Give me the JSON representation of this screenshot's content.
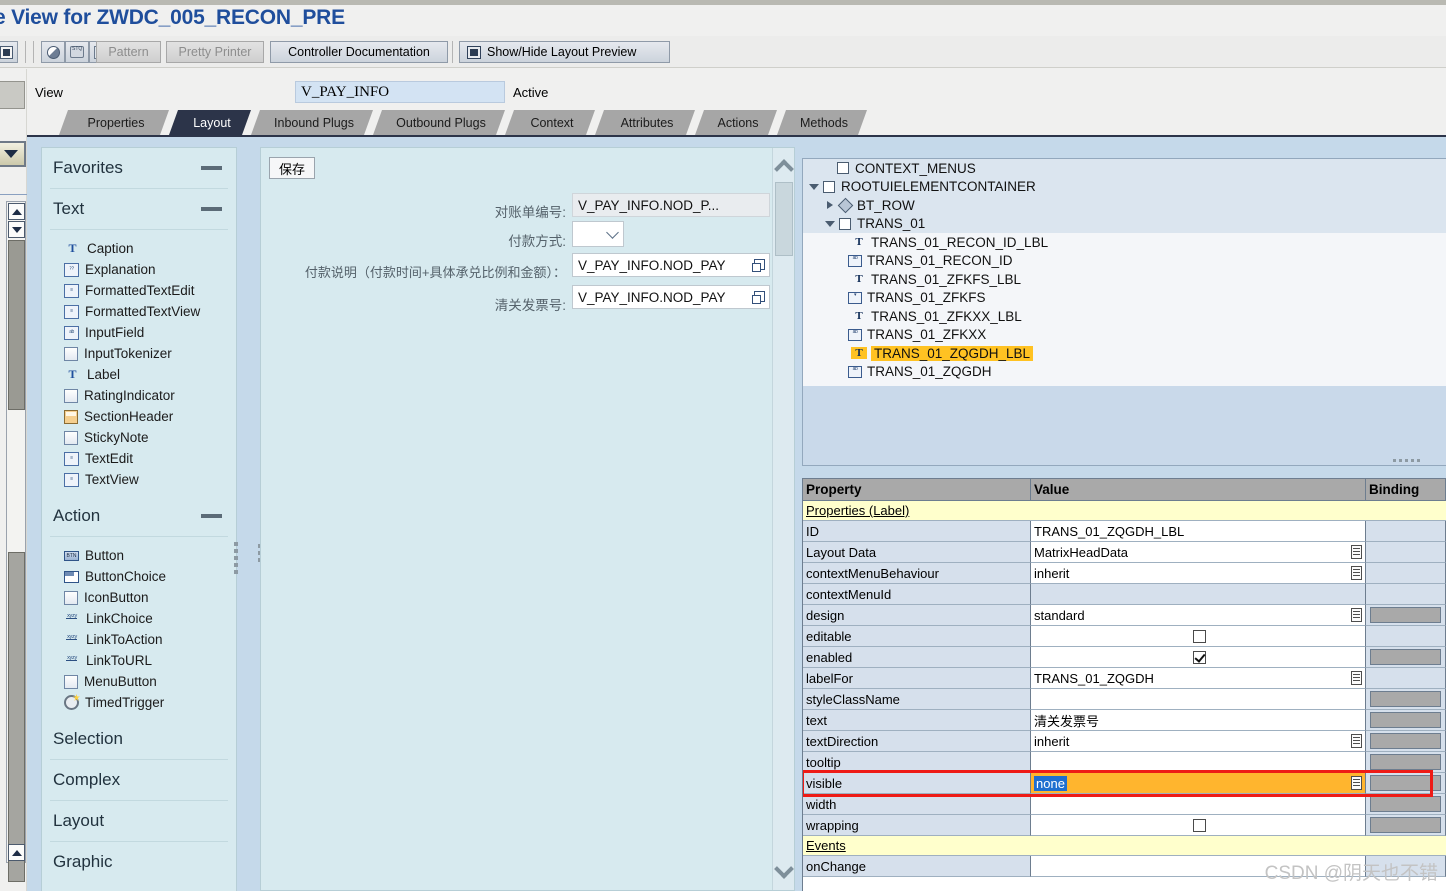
{
  "window": {
    "title": "e View for ZWDC_005_RECON_PRE"
  },
  "toolbar": {
    "items": [
      {
        "name": "display-icon",
        "label": "",
        "icon": "square-icon",
        "disabled": false
      },
      {
        "name": "where-used-icon",
        "label": "",
        "icon": "circle-icon",
        "disabled": false
      },
      {
        "name": "stq-icon",
        "label": "",
        "icon": "stack-icon",
        "disabled": false
      },
      {
        "name": "wand-icon",
        "label": "",
        "icon": "wand-icon",
        "disabled": false
      }
    ],
    "pattern_label": "Pattern",
    "pretty_printer_label": "Pretty Printer",
    "controller_documentation_label": "Controller Documentation",
    "show_hide_layout_preview_label": "Show/Hide Layout Preview"
  },
  "view_row": {
    "label": "View",
    "value": "V_PAY_INFO",
    "status": "Active"
  },
  "tabs": [
    {
      "label": "Properties",
      "active": false
    },
    {
      "label": "Layout",
      "active": true
    },
    {
      "label": "Inbound Plugs",
      "active": false
    },
    {
      "label": "Outbound Plugs",
      "active": false
    },
    {
      "label": "Context",
      "active": false
    },
    {
      "label": "Attributes",
      "active": false
    },
    {
      "label": "Actions",
      "active": false
    },
    {
      "label": "Methods",
      "active": false
    }
  ],
  "palette": {
    "sections": [
      {
        "title": "Favorites",
        "state": "expanded",
        "collapse_icon": "minus-icon",
        "items": []
      },
      {
        "title": "Text",
        "state": "expanded",
        "collapse_icon": "minus-icon",
        "items": [
          {
            "label": "Caption",
            "icon": "caption-icon"
          },
          {
            "label": "Explanation",
            "icon": "explanation-icon"
          },
          {
            "label": "FormattedTextEdit",
            "icon": "formatted-text-edit-icon"
          },
          {
            "label": "FormattedTextView",
            "icon": "formatted-text-view-icon"
          },
          {
            "label": "InputField",
            "icon": "input-field-icon"
          },
          {
            "label": "InputTokenizer",
            "icon": "input-tokenizer-icon"
          },
          {
            "label": "Label",
            "icon": "label-icon"
          },
          {
            "label": "RatingIndicator",
            "icon": "rating-indicator-icon"
          },
          {
            "label": "SectionHeader",
            "icon": "section-header-icon"
          },
          {
            "label": "StickyNote",
            "icon": "sticky-note-icon"
          },
          {
            "label": "TextEdit",
            "icon": "text-edit-icon"
          },
          {
            "label": "TextView",
            "icon": "text-view-icon"
          }
        ]
      },
      {
        "title": "Action",
        "state": "expanded",
        "collapse_icon": "minus-icon",
        "items": [
          {
            "label": "Button",
            "icon": "button-icon"
          },
          {
            "label": "ButtonChoice",
            "icon": "button-choice-icon"
          },
          {
            "label": "IconButton",
            "icon": "icon-button-icon"
          },
          {
            "label": "LinkChoice",
            "icon": "link-choice-icon"
          },
          {
            "label": "LinkToAction",
            "icon": "link-to-action-icon"
          },
          {
            "label": "LinkToURL",
            "icon": "link-to-url-icon"
          },
          {
            "label": "MenuButton",
            "icon": "menu-button-icon"
          },
          {
            "label": "TimedTrigger",
            "icon": "timed-trigger-icon"
          }
        ]
      },
      {
        "title": "Selection",
        "state": "collapsed",
        "collapse_icon": "box-icon",
        "items": []
      },
      {
        "title": "Complex",
        "state": "collapsed",
        "collapse_icon": "box-icon",
        "items": []
      },
      {
        "title": "Layout",
        "state": "collapsed",
        "collapse_icon": "box-icon",
        "items": []
      },
      {
        "title": "Graphic",
        "state": "collapsed",
        "collapse_icon": "box-icon",
        "items": []
      }
    ]
  },
  "preview": {
    "save_button": "保存",
    "fields": [
      {
        "label": "对账单编号:",
        "value": "V_PAY_INFO.NOD_P...",
        "type": "input",
        "readonly": true,
        "binding_icon": false
      },
      {
        "label": "付款方式:",
        "value": "",
        "type": "dropdown",
        "readonly": false,
        "binding_icon": false
      },
      {
        "label": "付款说明（付款时间+具体承兑比例和金额）：",
        "value": "V_PAY_INFO.NOD_PAY",
        "type": "input",
        "readonly": false,
        "binding_icon": true
      },
      {
        "label": "清关发票号:",
        "value": "V_PAY_INFO.NOD_PAY",
        "type": "input",
        "readonly": false,
        "binding_icon": true
      }
    ]
  },
  "tree": {
    "nodes": [
      {
        "label": "CONTEXT_MENUS",
        "indent": 1,
        "twisty": "none",
        "icon": "checkbox-icon",
        "selected": false,
        "shaded": true
      },
      {
        "label": "ROOTUIELEMENTCONTAINER",
        "indent": 0,
        "twisty": "expanded",
        "icon": "checkbox-icon",
        "selected": false,
        "shaded": true
      },
      {
        "label": "BT_ROW",
        "indent": 1,
        "twisty": "collapsed",
        "icon": "diamond-icon",
        "selected": false,
        "shaded": true
      },
      {
        "label": "TRANS_01",
        "indent": 1,
        "twisty": "expanded",
        "icon": "checkbox-icon",
        "selected": false,
        "shaded": true
      },
      {
        "label": "TRANS_01_RECON_ID_LBL",
        "indent": 3,
        "twisty": "none",
        "icon": "label-icon",
        "selected": false,
        "shaded": false
      },
      {
        "label": "TRANS_01_RECON_ID",
        "indent": 3,
        "twisty": "none",
        "icon": "input-field-icon",
        "selected": false,
        "shaded": false
      },
      {
        "label": "TRANS_01_ZFKFS_LBL",
        "indent": 3,
        "twisty": "none",
        "icon": "label-icon",
        "selected": false,
        "shaded": false
      },
      {
        "label": "TRANS_01_ZFKFS",
        "indent": 3,
        "twisty": "none",
        "icon": "dropdown-icon",
        "selected": false,
        "shaded": false
      },
      {
        "label": "TRANS_01_ZFKXX_LBL",
        "indent": 3,
        "twisty": "none",
        "icon": "label-icon",
        "selected": false,
        "shaded": false
      },
      {
        "label": "TRANS_01_ZFKXX",
        "indent": 3,
        "twisty": "none",
        "icon": "input-field-icon",
        "selected": false,
        "shaded": false
      },
      {
        "label": "TRANS_01_ZQGDH_LBL",
        "indent": 3,
        "twisty": "none",
        "icon": "label-icon",
        "selected": true,
        "shaded": false
      },
      {
        "label": "TRANS_01_ZQGDH",
        "indent": 3,
        "twisty": "none",
        "icon": "input-field-icon",
        "selected": false,
        "shaded": false
      }
    ]
  },
  "property_table": {
    "columns": [
      "Property",
      "Value",
      "Binding"
    ],
    "rows": [
      {
        "kind": "group",
        "property": "Properties (Label)"
      },
      {
        "kind": "row",
        "property": "ID",
        "value": "TRANS_01_ZQGDH_LBL",
        "value_kind": "text",
        "dropdown": false,
        "binding": false
      },
      {
        "kind": "row",
        "property": "Layout Data",
        "value": "MatrixHeadData",
        "value_kind": "text",
        "dropdown": true,
        "binding": false
      },
      {
        "kind": "row",
        "property": "contextMenuBehaviour",
        "value": "inherit",
        "value_kind": "text",
        "dropdown": true,
        "binding": false
      },
      {
        "kind": "row",
        "property": "contextMenuId",
        "value": "",
        "value_kind": "disabled",
        "dropdown": false,
        "binding": false
      },
      {
        "kind": "row",
        "property": "design",
        "value": "standard",
        "value_kind": "text",
        "dropdown": true,
        "binding": true
      },
      {
        "kind": "row",
        "property": "editable",
        "value": "",
        "value_kind": "checkbox",
        "checked": false,
        "dropdown": false,
        "binding": false
      },
      {
        "kind": "row",
        "property": "enabled",
        "value": "",
        "value_kind": "checkbox",
        "checked": true,
        "dropdown": false,
        "binding": true
      },
      {
        "kind": "row",
        "property": "labelFor",
        "value": "TRANS_01_ZQGDH",
        "value_kind": "text",
        "dropdown": true,
        "binding": false
      },
      {
        "kind": "row",
        "property": "styleClassName",
        "value": "",
        "value_kind": "text",
        "dropdown": false,
        "binding": true
      },
      {
        "kind": "row",
        "property": "text",
        "value": "清关发票号",
        "value_kind": "text",
        "dropdown": false,
        "binding": true
      },
      {
        "kind": "row",
        "property": "textDirection",
        "value": "inherit",
        "value_kind": "text",
        "dropdown": true,
        "binding": true
      },
      {
        "kind": "row",
        "property": "tooltip",
        "value": "",
        "value_kind": "text",
        "dropdown": false,
        "binding": true
      },
      {
        "kind": "row",
        "property": "visible",
        "value": "none",
        "value_kind": "selected",
        "dropdown": true,
        "binding": true,
        "highlight": true
      },
      {
        "kind": "row",
        "property": "width",
        "value": "",
        "value_kind": "text",
        "dropdown": false,
        "binding": true
      },
      {
        "kind": "row",
        "property": "wrapping",
        "value": "",
        "value_kind": "checkbox",
        "checked": false,
        "dropdown": false,
        "binding": true
      },
      {
        "kind": "group",
        "property": "Events"
      },
      {
        "kind": "row",
        "property": "onChange",
        "value": "",
        "value_kind": "text",
        "dropdown": false,
        "binding": false
      }
    ]
  },
  "watermark": {
    "text": "CSDN @阴天也不错"
  },
  "colors": {
    "title_blue": "#1f4e9c",
    "tab_active_bg": "#2c3449",
    "tab_inactive_bg": "#a6a6a6",
    "palette_bg": "#d7eaef",
    "content_bg": "#c5d9ea",
    "selection_yellow": "#ffc222",
    "highlight_orange": "#ffb52e",
    "group_row_yellow": "#ffffcc",
    "red_box": "#ee1b16",
    "binding_gray": "#a9a9a9"
  }
}
